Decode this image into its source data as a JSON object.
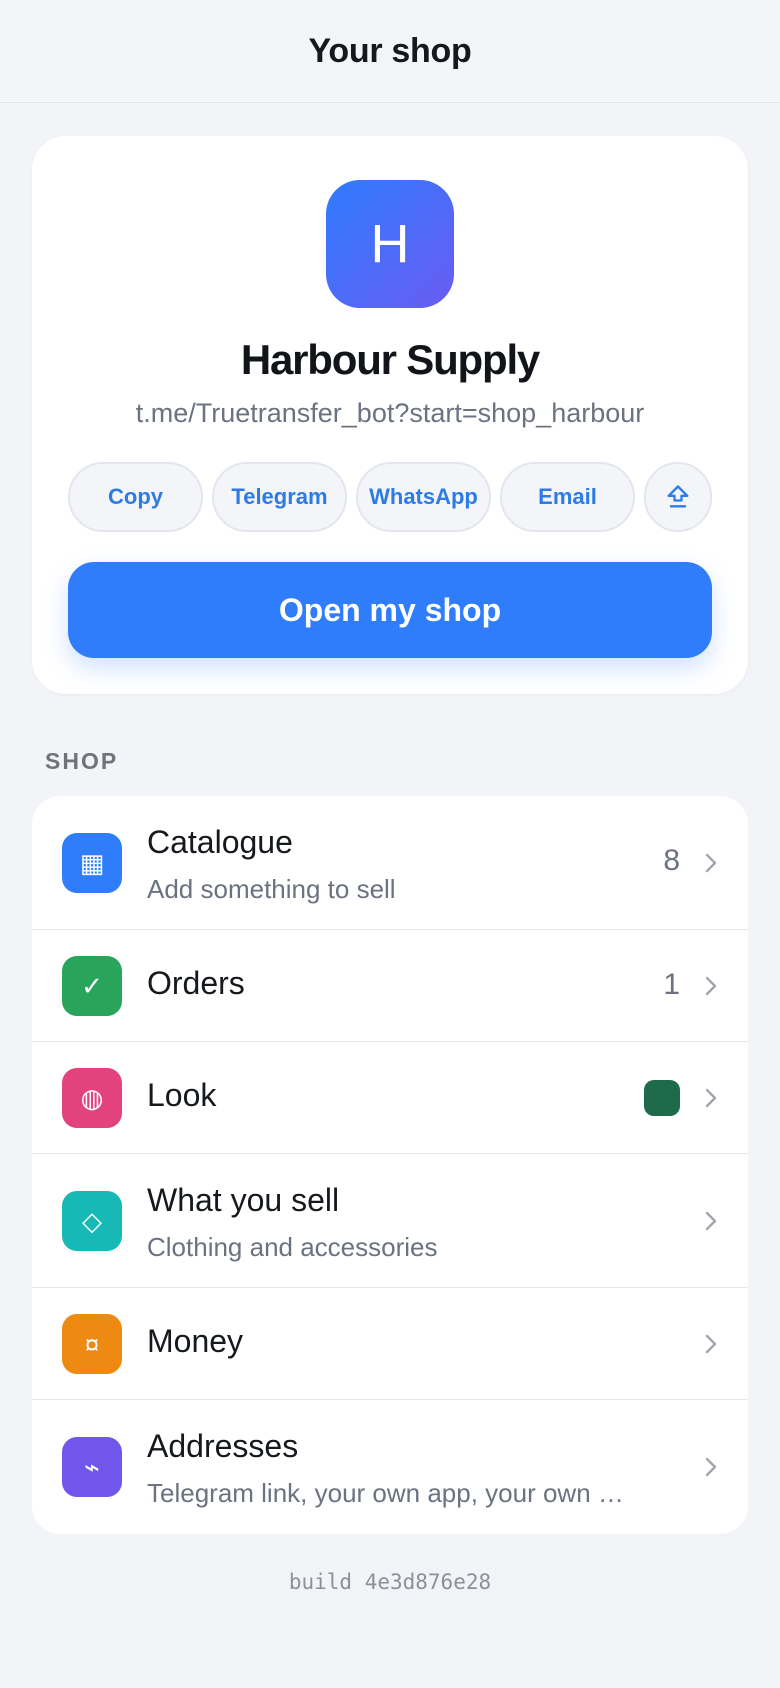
{
  "header": {
    "title": "Your shop"
  },
  "shop": {
    "avatar_letter": "H",
    "name": "Harbour Supply",
    "link": "t.me/Truetransfer_bot?start=shop_harbour",
    "share_buttons": [
      {
        "label": "Copy"
      },
      {
        "label": "Telegram"
      },
      {
        "label": "WhatsApp"
      },
      {
        "label": "Email"
      },
      {
        "icon": "share-icon"
      }
    ],
    "open_button_label": "Open my shop"
  },
  "section": {
    "label": "SHOP"
  },
  "menu": {
    "items": [
      {
        "title": "Catalogue",
        "subtitle": "Add something to sell",
        "count": "8",
        "icon": "grid-icon",
        "icon_glyph": "▦",
        "icon_color": "#2f7dfb"
      },
      {
        "title": "Orders",
        "count": "1",
        "icon": "check-icon",
        "icon_glyph": "✓",
        "icon_color": "#28a55a"
      },
      {
        "title": "Look",
        "icon": "palette-icon",
        "icon_glyph": "◍",
        "icon_color": "#e2437c",
        "swatch_color": "#1e6a4a"
      },
      {
        "title": "What you sell",
        "subtitle": "Clothing and accessories",
        "icon": "diamond-icon",
        "icon_glyph": "◇",
        "icon_color": "#16b9b6"
      },
      {
        "title": "Money",
        "icon": "currency-icon",
        "icon_glyph": "¤",
        "icon_color": "#ee8a12"
      },
      {
        "title": "Addresses",
        "subtitle": "Telegram link, your own app, your own …",
        "icon": "link-icon",
        "icon_glyph": "⌁",
        "icon_color": "#7156ec"
      }
    ]
  },
  "footer": {
    "build": "build 4e3d876e28"
  }
}
